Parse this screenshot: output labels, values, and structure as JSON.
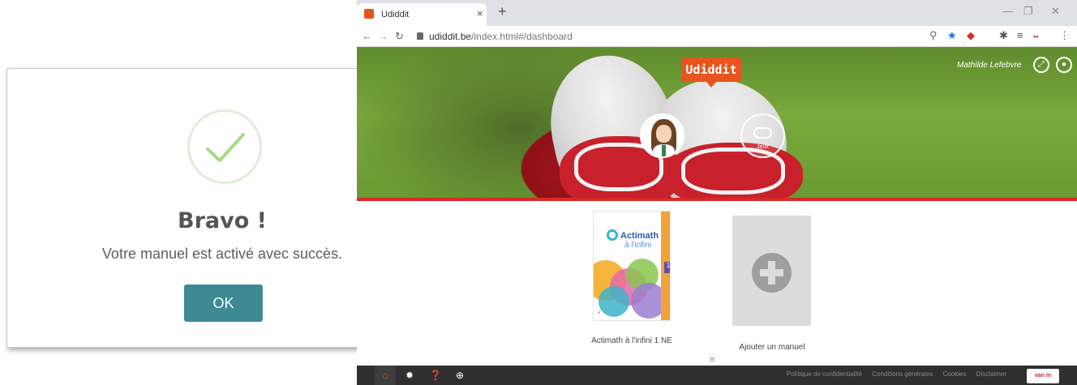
{
  "dialog": {
    "title": "Bravo !",
    "message": "Votre manuel est activé avec succès.",
    "ok_label": "OK"
  },
  "browser": {
    "tab_title": "Udiddit",
    "tab_close": "×",
    "new_tab": "+",
    "url_host": "udiddit.be",
    "url_path": "/index.html#/dashboard",
    "win_minimize": "—",
    "win_restore": "❐",
    "win_close": "✕"
  },
  "page": {
    "logo": "Udiddit",
    "user_name": "Mathilde Lefebvre",
    "games_label": "Jeux",
    "book": {
      "cover_title": "Actimath",
      "cover_subtitle": "à l'infini",
      "cover_number": "1",
      "title": "Actimath à l'infini 1 NE"
    },
    "add_manual_label": "Ajouter un manuel",
    "menu_icon": "≡"
  },
  "footer": {
    "links": [
      "Politique de confidentialité",
      "Conditions générales",
      "Cookies",
      "Disclaimer"
    ],
    "brand": "van in"
  },
  "colors": {
    "accent_orange": "#e8541e",
    "ok_button": "#3d8a93",
    "hero_red_line": "#d9292a",
    "arrow_blue": "#4472c4"
  }
}
